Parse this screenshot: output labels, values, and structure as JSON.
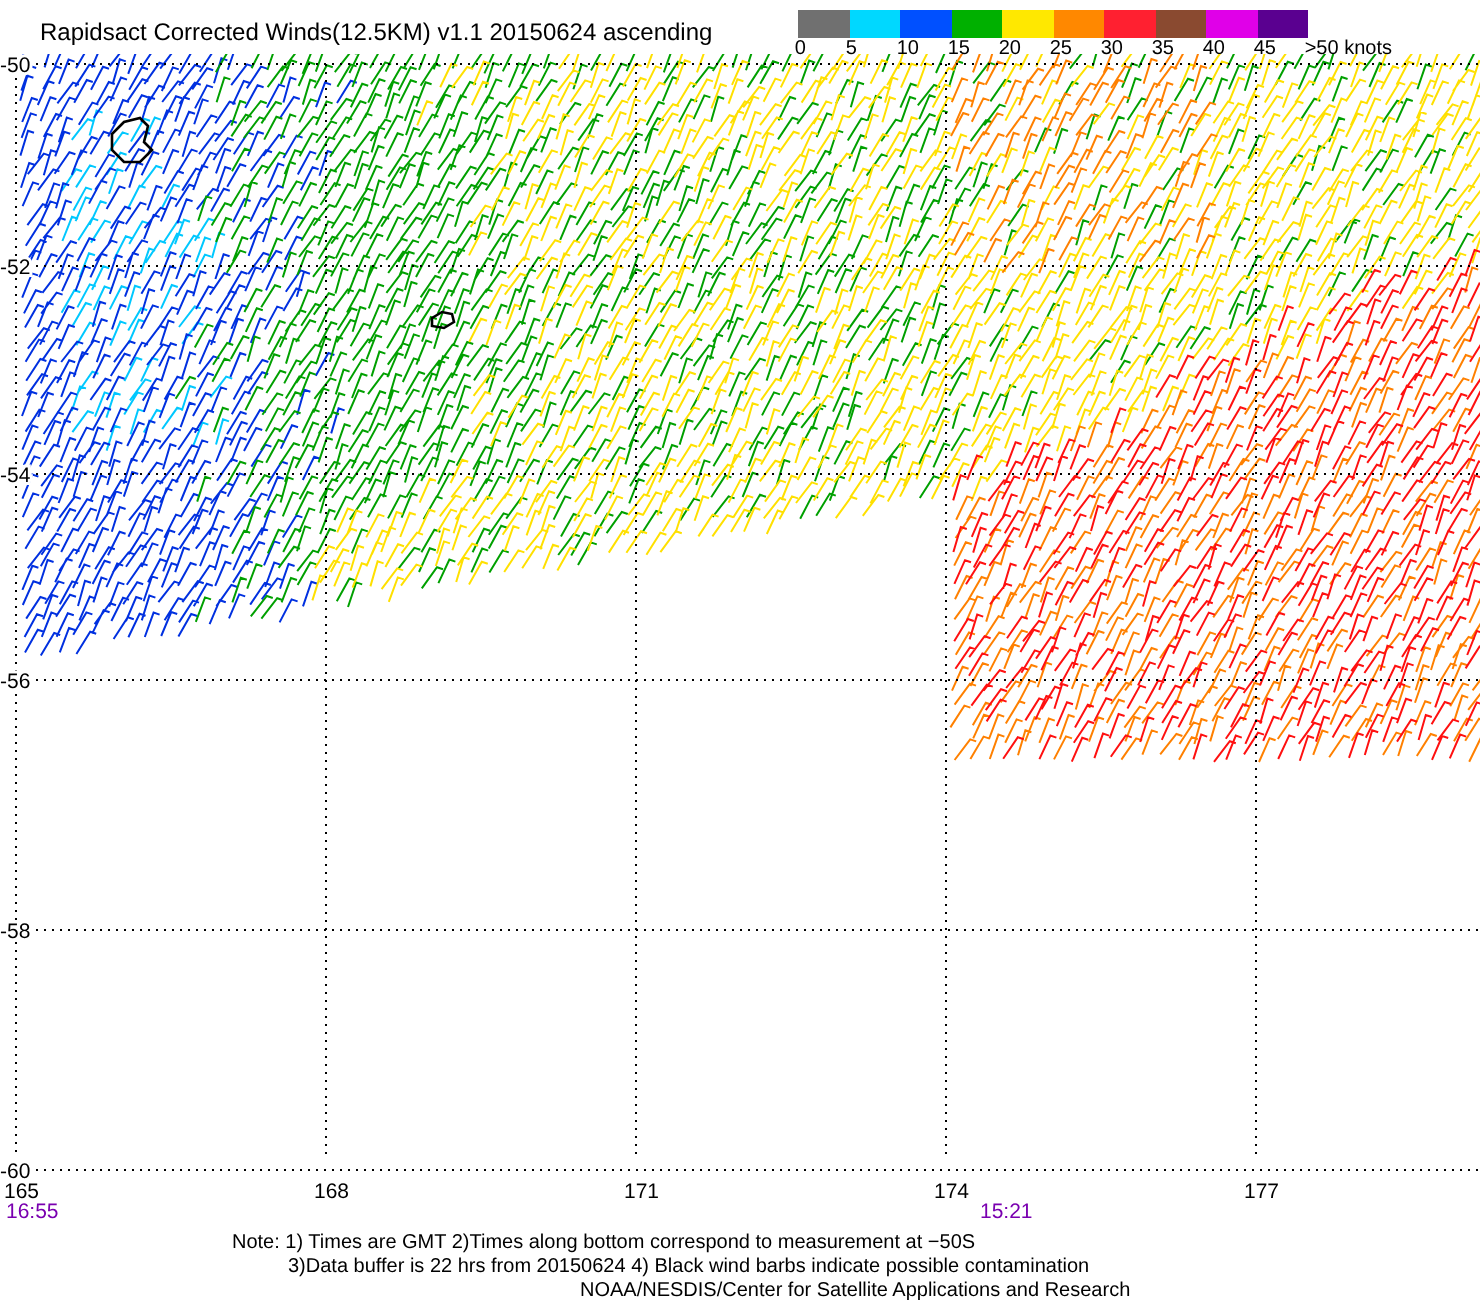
{
  "title": "Rapidsact Corrected Winds(12.5KM) v1.1 20150624 ascending",
  "legend": {
    "segments": [
      {
        "color": "#707070"
      },
      {
        "color": "#00d8ff"
      },
      {
        "color": "#0050ff"
      },
      {
        "color": "#00b000"
      },
      {
        "color": "#ffe800"
      },
      {
        "color": "#ff8800"
      },
      {
        "color": "#ff2030"
      },
      {
        "color": "#8a4a30"
      },
      {
        "color": "#e000e8"
      },
      {
        "color": "#5a0090"
      }
    ],
    "labels": [
      "0",
      "5",
      "10",
      "15",
      "20",
      "25",
      "30",
      "35",
      "40",
      "45",
      ">50 knots"
    ]
  },
  "map": {
    "lat_labels": [
      "-50",
      "-52",
      "-54",
      "-56",
      "-58",
      "-60"
    ],
    "lon_labels": [
      "165",
      "168",
      "171",
      "174",
      "177"
    ],
    "time_labels": [
      "16:55",
      "15:21"
    ]
  },
  "notes": [
    "Note: 1) Times are GMT 2)Times along bottom correspond to measurement at −50S",
    "3)Data buffer is 22 hrs from 20150624 4) Black wind barbs indicate possible contamination",
    "NOAA/NESDIS/Center for Satellite Applications and Research"
  ]
}
